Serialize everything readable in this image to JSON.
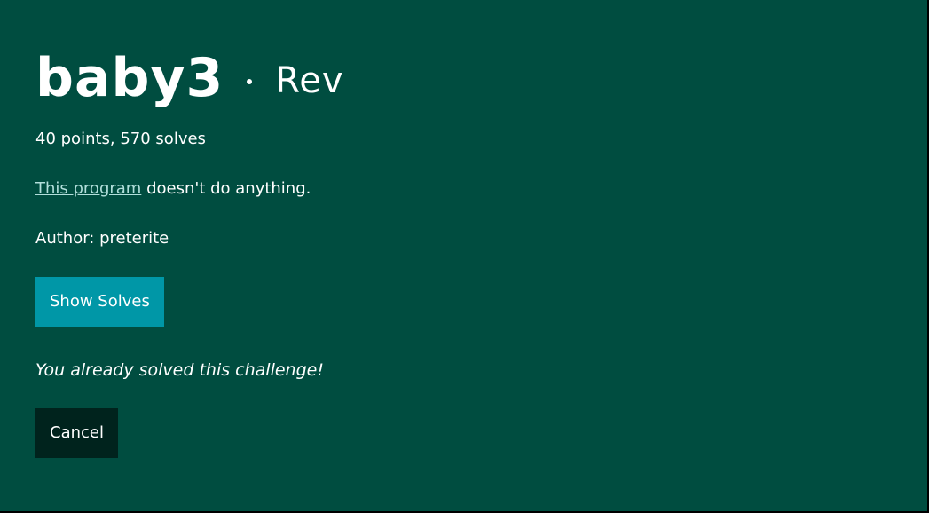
{
  "challenge": {
    "name": "baby3",
    "separator": "•",
    "category": "Rev",
    "stats": "40 points, 570 solves",
    "description_link": "This program",
    "description_rest": " doesn't do anything.",
    "author": "Author: preterite"
  },
  "buttons": {
    "show_solves": "Show Solves",
    "cancel": "Cancel"
  },
  "status": {
    "solved_message": "You already solved this challenge!"
  },
  "colors": {
    "modal_background": "#004d40",
    "show_solves_background": "#0097a7",
    "cancel_background": "#00231d",
    "link": "#b2dfdb"
  }
}
